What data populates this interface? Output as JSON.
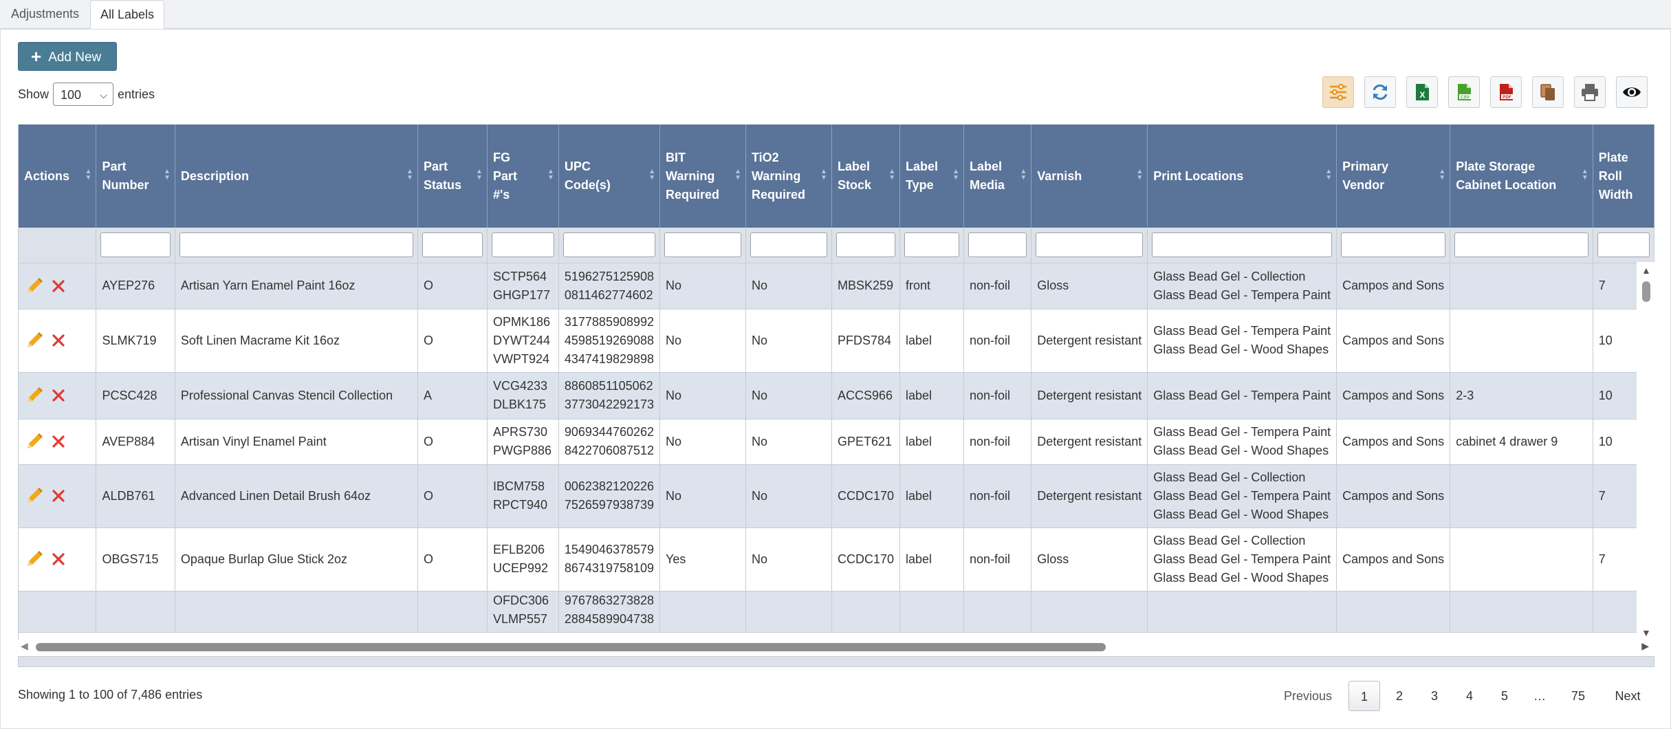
{
  "tabs": [
    {
      "label": "Adjustments"
    },
    {
      "label": "All Labels"
    }
  ],
  "toolbar": {
    "add_new_label": "Add New",
    "show_label": "Show",
    "entries_value": "100",
    "entries_label": "entries",
    "buttons": [
      "columns-settings-icon",
      "refresh-icon",
      "excel-icon",
      "csv-icon",
      "pdf-icon",
      "copy-icon",
      "print-icon",
      "visibility-icon"
    ]
  },
  "table": {
    "headers": [
      "Actions",
      "Part Number",
      "Description",
      "Part Status",
      "FG Part #'s",
      "UPC Code(s)",
      "BIT Warning Required",
      "TiO2 Warning Required",
      "Label Stock",
      "Label Type",
      "Label Media",
      "Varnish",
      "Print Locations",
      "Primary Vendor",
      "Plate Storage Cabinet Location",
      "Plate Roll Width"
    ],
    "rows": [
      {
        "part": "AYEP276",
        "desc": "Artisan Yarn Enamel Paint 16oz",
        "status": "O",
        "fg": [
          "SCTP564",
          "GHGP177"
        ],
        "upc": [
          "5196275125908",
          "0811462774602"
        ],
        "bit": "No",
        "tio2": "No",
        "stock": "MBSK259",
        "type": "front",
        "media": "non-foil",
        "varnish": "Gloss",
        "print": [
          "Glass Bead Gel - Collection",
          "Glass Bead Gel - Tempera Paint"
        ],
        "vendor": "Campos and Sons",
        "cabinet": "",
        "width": "7"
      },
      {
        "part": "SLMK719",
        "desc": "Soft Linen Macrame Kit 16oz",
        "status": "O",
        "fg": [
          "OPMK186",
          "DYWT244",
          "VWPT924"
        ],
        "upc": [
          "3177885908992",
          "4598519269088",
          "4347419829898"
        ],
        "bit": "No",
        "tio2": "No",
        "stock": "PFDS784",
        "type": "label",
        "media": "non-foil",
        "varnish": "Detergent resistant",
        "print": [
          "Glass Bead Gel - Tempera Paint",
          "Glass Bead Gel - Wood Shapes"
        ],
        "vendor": "Campos and Sons",
        "cabinet": "",
        "width": "10"
      },
      {
        "part": "PCSC428",
        "desc": "Professional Canvas Stencil Collection",
        "status": "A",
        "fg": [
          "VCG4233",
          "DLBK175"
        ],
        "upc": [
          "8860851105062",
          "3773042292173"
        ],
        "bit": "No",
        "tio2": "No",
        "stock": "ACCS966",
        "type": "label",
        "media": "non-foil",
        "varnish": "Detergent resistant",
        "print": [
          "Glass Bead Gel - Tempera Paint"
        ],
        "vendor": "Campos and Sons",
        "cabinet": "2-3",
        "width": "10"
      },
      {
        "part": "AVEP884",
        "desc": "Artisan Vinyl Enamel Paint",
        "status": "O",
        "fg": [
          "APRS730",
          "PWGP886"
        ],
        "upc": [
          "9069344760262",
          "8422706087512"
        ],
        "bit": "No",
        "tio2": "No",
        "stock": "GPET621",
        "type": "label",
        "media": "non-foil",
        "varnish": "Detergent resistant",
        "print": [
          "Glass Bead Gel - Tempera Paint",
          "Glass Bead Gel - Wood Shapes"
        ],
        "vendor": "Campos and Sons",
        "cabinet": "cabinet 4 drawer 9",
        "width": "10"
      },
      {
        "part": "ALDB761",
        "desc": "Advanced Linen Detail Brush 64oz",
        "status": "O",
        "fg": [
          "IBCM758",
          "RPCT940"
        ],
        "upc": [
          "0062382120226",
          "7526597938739"
        ],
        "bit": "No",
        "tio2": "No",
        "stock": "CCDC170",
        "type": "label",
        "media": "non-foil",
        "varnish": "Detergent resistant",
        "print": [
          "Glass Bead Gel - Collection",
          "Glass Bead Gel - Tempera Paint",
          "Glass Bead Gel - Wood Shapes"
        ],
        "vendor": "Campos and Sons",
        "cabinet": "",
        "width": "7"
      },
      {
        "part": "OBGS715",
        "desc": "Opaque Burlap Glue Stick 2oz",
        "status": "O",
        "fg": [
          "EFLB206",
          "UCEP992"
        ],
        "upc": [
          "1549046378579",
          "8674319758109"
        ],
        "bit": "Yes",
        "tio2": "No",
        "stock": "CCDC170",
        "type": "label",
        "media": "non-foil",
        "varnish": "Gloss",
        "print": [
          "Glass Bead Gel - Collection",
          "Glass Bead Gel - Tempera Paint",
          "Glass Bead Gel - Wood Shapes"
        ],
        "vendor": "Campos and Sons",
        "cabinet": "",
        "width": "7"
      },
      {
        "part": "",
        "desc": "",
        "status": "",
        "fg": [
          "OFDC306",
          "VLMP557"
        ],
        "upc": [
          "9767863273828",
          "2884589904738"
        ],
        "bit": "",
        "tio2": "",
        "stock": "",
        "type": "",
        "media": "",
        "varnish": "",
        "print": [],
        "vendor": "",
        "cabinet": "",
        "width": "",
        "partial": true
      }
    ]
  },
  "footer": {
    "info": "Showing 1 to 100 of 7,486 entries",
    "previous": "Previous",
    "pages": [
      "1",
      "2",
      "3",
      "4",
      "5",
      "…",
      "75"
    ],
    "next": "Next"
  },
  "colors": {
    "header": "#5a7398",
    "odd_row": "#dde3ec",
    "add_button": "#4a7d94",
    "edit": "#f0a81c",
    "delete": "#e03a32"
  }
}
